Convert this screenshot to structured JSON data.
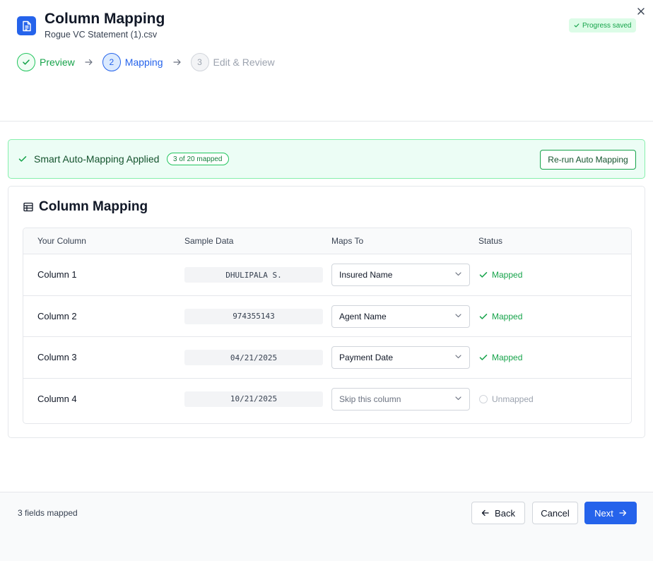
{
  "header": {
    "title": "Column Mapping",
    "filename": "Rogue VC Statement (1).csv",
    "saved_badge": "Progress saved"
  },
  "steps": [
    {
      "number": "1",
      "label": "Preview",
      "state": "done"
    },
    {
      "number": "2",
      "label": "Mapping",
      "state": "active"
    },
    {
      "number": "3",
      "label": "Edit & Review",
      "state": "todo"
    }
  ],
  "banner": {
    "title": "Smart Auto-Mapping Applied",
    "badge": "3 of 20 mapped",
    "rerun_label": "Re-run Auto Mapping"
  },
  "card": {
    "title": "Column Mapping",
    "headers": [
      "Your Column",
      "Sample Data",
      "Maps To",
      "Status"
    ],
    "rows": [
      {
        "column": "Column 1",
        "sample": "DHULIPALA S.",
        "maps_to": "Insured Name",
        "status": "Mapped"
      },
      {
        "column": "Column 2",
        "sample": "974355143",
        "maps_to": "Agent Name",
        "status": "Mapped"
      },
      {
        "column": "Column 3",
        "sample": "04/21/2025",
        "maps_to": "Payment Date",
        "status": "Mapped"
      },
      {
        "column": "Column 4",
        "sample": "10/21/2025",
        "maps_to": "Skip this column",
        "status": "Unmapped"
      }
    ]
  },
  "footer": {
    "status": "3 fields mapped",
    "back_label": "Back",
    "cancel_label": "Cancel",
    "next_label": "Next"
  },
  "colors": {
    "primary": "#2563eb",
    "success": "#16a34a",
    "success_bg": "#ecfdf5",
    "muted": "#9ca3af"
  }
}
